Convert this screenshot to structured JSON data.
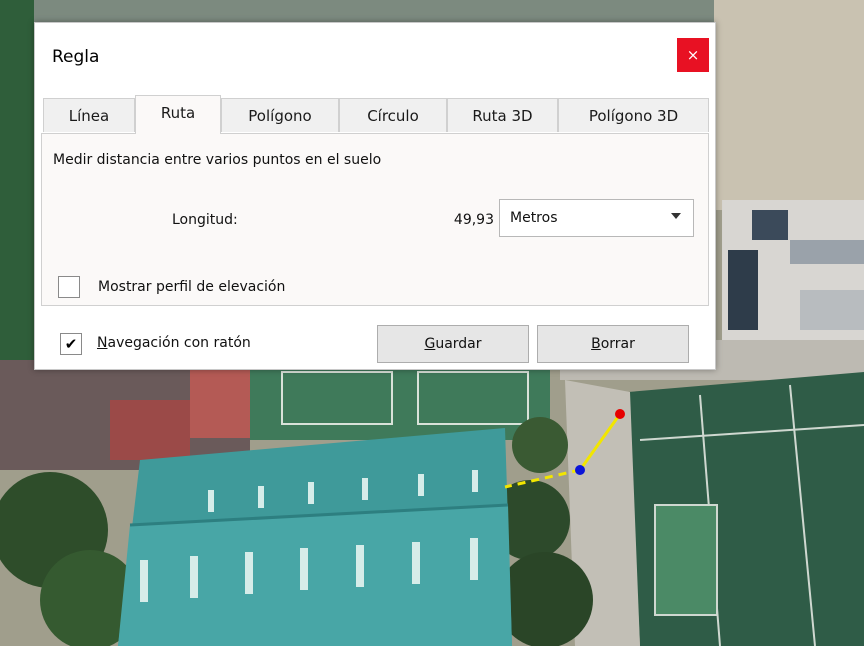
{
  "dialog": {
    "title": "Regla",
    "close_glyph": "×",
    "accent_close": "#e81123"
  },
  "tabs": [
    {
      "label": "Línea",
      "active": false
    },
    {
      "label": "Ruta",
      "active": true
    },
    {
      "label": "Polígono",
      "active": false
    },
    {
      "label": "Círculo",
      "active": false
    },
    {
      "label": "Ruta 3D",
      "active": false
    },
    {
      "label": "Polígono 3D",
      "active": false
    }
  ],
  "panel": {
    "description": "Medir distancia entre varios puntos en el suelo",
    "length_label": "Longitud:",
    "length_value": "49,93",
    "unit_selected": "Metros",
    "elevation_profile_label": "Mostrar perfil de elevación",
    "elevation_profile_checked": false
  },
  "footer": {
    "nav_checked": true,
    "nav_check_glyph": "✔",
    "nav_label_first": "N",
    "nav_label_rest": "avegación con ratón",
    "save_first": "G",
    "save_rest": "uardar",
    "clear_first": "B",
    "clear_rest": "orrar"
  },
  "map": {
    "path_color": "#f2e600",
    "start_point_color": "#e60000",
    "mid_point_color": "#0a14d8"
  }
}
